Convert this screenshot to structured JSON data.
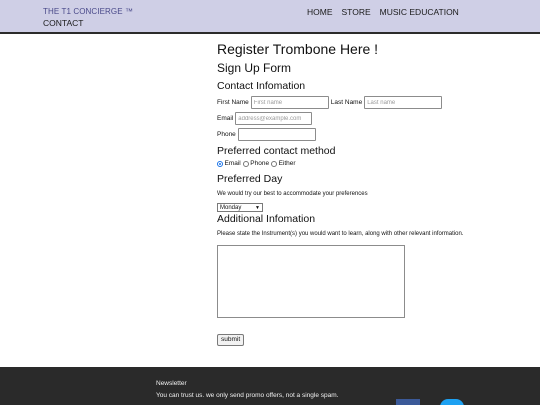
{
  "header": {
    "brand": "THE T1 CONCIERGE ™",
    "contact": "CONTACT",
    "nav": [
      "HOME",
      "STORE",
      "MUSIC EDUCATION"
    ]
  },
  "form": {
    "title": "Register Trombone Here !",
    "subtitle": "Sign Up Form",
    "contact_heading": "Contact Infomation",
    "first_name_label": "First Name",
    "first_name_placeholder": "First name",
    "last_name_label": "Last Name",
    "last_name_placeholder": "Last name",
    "email_label": "Email",
    "email_placeholder": "address@example.com",
    "phone_label": "Phone",
    "method_heading": "Preferred contact method",
    "method_options": [
      "Email",
      "Phone",
      "Either"
    ],
    "method_selected": "Email",
    "day_heading": "Preferred Day",
    "day_note": "We would try our best to accommodate your preferences",
    "day_selected": "Monday",
    "additional_heading": "Additional Infomation",
    "additional_note": "Please state the Instrument(s) you would want to learn, along with other relevant information.",
    "submit_label": "submit"
  },
  "footer": {
    "title": "Newsletter",
    "text": "You can trust us. we only send promo offers, not a single spam."
  }
}
